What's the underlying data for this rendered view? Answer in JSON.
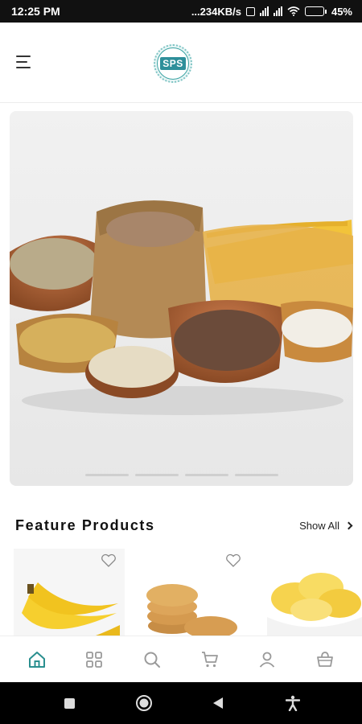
{
  "status_bar": {
    "time": "12:25 PM",
    "network_speed": "...234KB/s",
    "battery": "45%",
    "battery_level": 0.45
  },
  "header": {
    "logo_text": "SPS",
    "icons": [
      "menu-icon"
    ]
  },
  "banner": {
    "slide_count": 4,
    "active_slide": 1
  },
  "feature_section": {
    "title": "Feature Products",
    "show_all_label": "Show All",
    "products": [
      {
        "image": "bananas"
      },
      {
        "image": "cookies"
      },
      {
        "image": "potato-chips"
      }
    ]
  },
  "bottom_nav": {
    "items": [
      "home",
      "categories",
      "search",
      "cart",
      "profile",
      "orders"
    ],
    "active": "home",
    "accent_color": "#2a8f8f",
    "inactive_color": "#9a9a9a"
  },
  "system_nav": [
    "recents",
    "home",
    "back",
    "accessibility"
  ]
}
